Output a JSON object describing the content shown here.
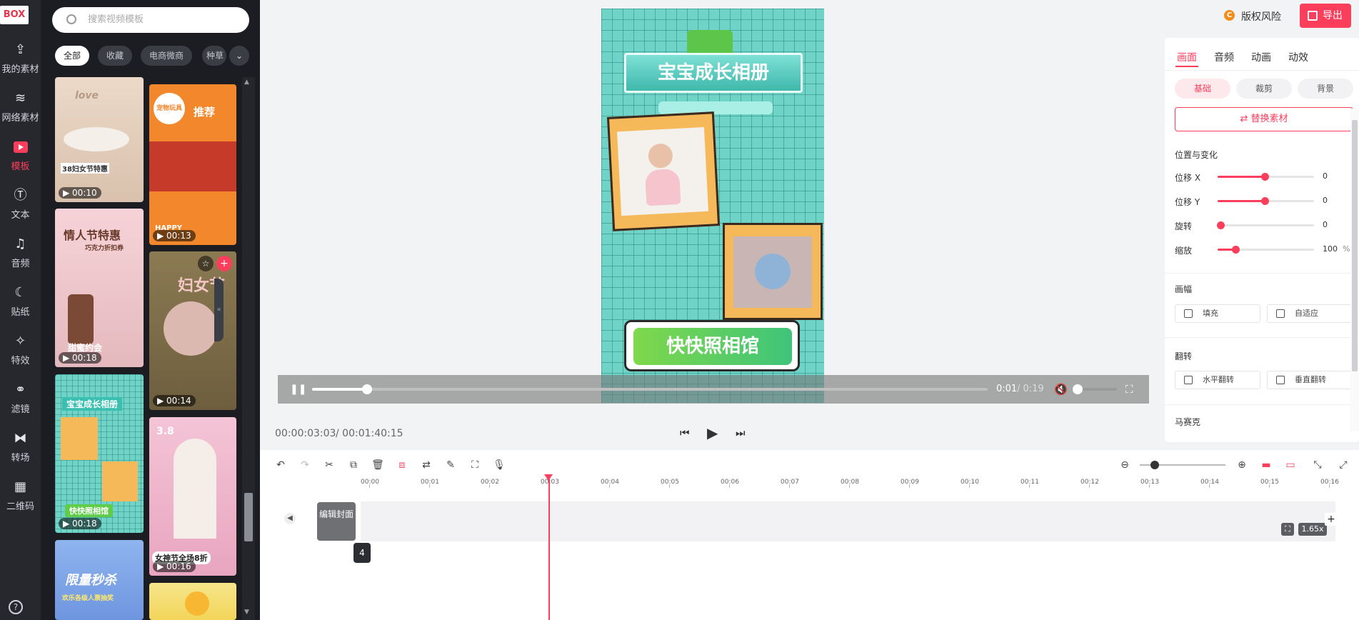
{
  "left_nav": {
    "logo": "BOX",
    "items": [
      {
        "label": "我的素材",
        "icon": "cloud-upload-icon"
      },
      {
        "label": "网络素材",
        "icon": "layers-icon"
      },
      {
        "label": "模板",
        "icon": "template-icon",
        "active": true
      },
      {
        "label": "文本",
        "icon": "text-icon"
      },
      {
        "label": "音频",
        "icon": "music-icon"
      },
      {
        "label": "贴纸",
        "icon": "sticker-icon"
      },
      {
        "label": "特效",
        "icon": "effects-icon"
      },
      {
        "label": "滤镜",
        "icon": "filter-icon"
      },
      {
        "label": "转场",
        "icon": "transition-icon"
      },
      {
        "label": "二维码",
        "icon": "qrcode-icon"
      }
    ],
    "help_icon": "?"
  },
  "template_panel": {
    "search_placeholder": "搜索视频模板",
    "chips": [
      "全部",
      "收藏",
      "电商微商",
      "种草"
    ],
    "chips_more": "⌄",
    "collapse": "«",
    "thumbs": [
      {
        "duration": "▶ 00:10",
        "text": "38妇女节特惠",
        "text2": "love"
      },
      {
        "duration": "▶ 00:13",
        "text": "推荐",
        "text2": "宠物玩具",
        "text3": "HAPPY"
      },
      {
        "duration": "▶ 00:18",
        "text": "情人节特惠",
        "text2": "巧克力折扣券",
        "text3": "甜蜜约会"
      },
      {
        "duration": "▶ 00:14",
        "text": "妇女节",
        "text2": "☆",
        "text3": "+"
      },
      {
        "duration": "▶ 00:18",
        "text": "宝宝成长相册",
        "text2": "快快照相馆"
      },
      {
        "duration": "▶ 00:16",
        "text": "女神节全场8折",
        "text2": "3.8"
      },
      {
        "duration": "",
        "text": "限量秒杀",
        "text2": "欢乐各级人票抽奖"
      },
      {
        "duration": "",
        "text": ""
      }
    ]
  },
  "preview": {
    "title": "宝宝成长相册",
    "sign": "快快照相馆",
    "current": "0:01",
    "total": "/ 0:19",
    "timecode_current": "00:00:03:03",
    "timecode_total": "/ 00:01:40:15",
    "progress_fraction": 0.08
  },
  "header": {
    "copyright": "版权风险",
    "copyright_badge": "C",
    "export": "导出"
  },
  "props": {
    "tabs": [
      "画面",
      "音频",
      "动画",
      "动效"
    ],
    "subtabs": [
      "基础",
      "裁剪",
      "背景"
    ],
    "replace": "⇄ 替换素材",
    "section_position": "位置与变化",
    "sliders": [
      {
        "label": "位移 X",
        "value": "0",
        "fraction": 0.5
      },
      {
        "label": "位移 Y",
        "value": "0",
        "fraction": 0.5
      },
      {
        "label": "旋转",
        "value": "0",
        "fraction": 0.0
      },
      {
        "label": "缩放",
        "value": "100",
        "unit": "%",
        "fraction": 0.18
      }
    ],
    "section_canvas": "画幅",
    "canvas_options": [
      "填充",
      "自适应"
    ],
    "section_flip": "翻转",
    "flip_options": [
      "水平翻转",
      "垂直翻转"
    ],
    "section_mosaic": "马赛克"
  },
  "timeline": {
    "ruler": [
      "00:00",
      "00:01",
      "00:02",
      "00:03",
      "00:04",
      "00:05",
      "00:06",
      "00:07",
      "00:08",
      "00:09",
      "00:10",
      "00:11",
      "00:12",
      "00:13",
      "00:14",
      "00:15",
      "00:16"
    ],
    "cover_button": "编辑封面",
    "clip_count": "4",
    "speed": "1.65x"
  }
}
